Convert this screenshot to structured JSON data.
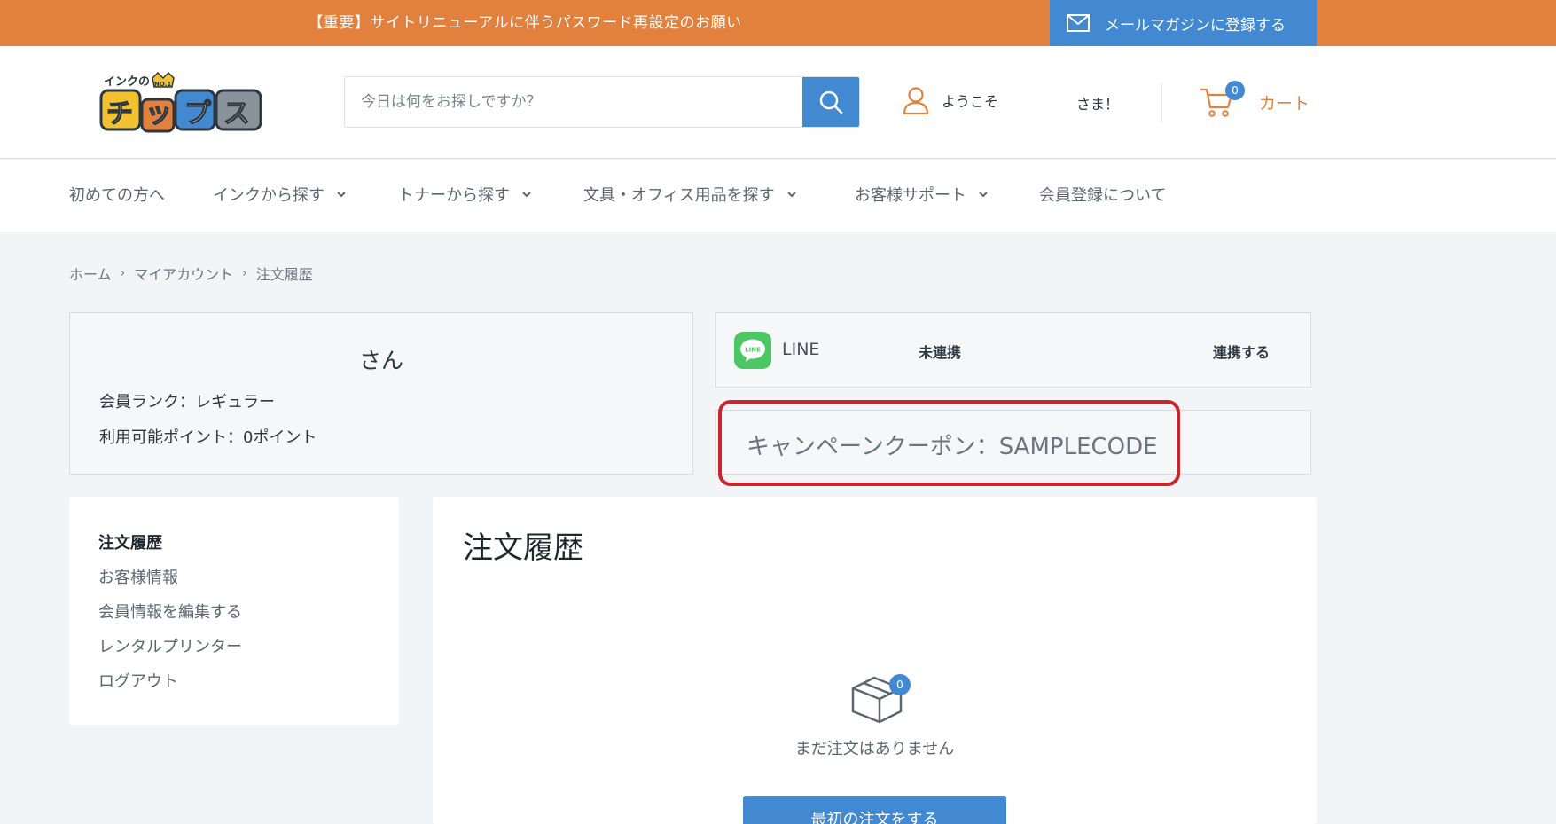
{
  "announcement": {
    "text": "【重要】サイトリニューアルに伴うパスワード再設定のお願い",
    "newsletter_label": "メールマガジンに登録する"
  },
  "header": {
    "logo_alt": "インクのチップス",
    "logo_small": "インクの",
    "logo_main": "チップス",
    "logo_badge": "NO.1",
    "search_placeholder": "今日は何をお探しですか？",
    "welcome": "ようこそ",
    "honorific": "さま！",
    "cart_label": "カート",
    "cart_count": "0"
  },
  "nav": {
    "items": [
      {
        "label": "初めての方へ",
        "dropdown": false
      },
      {
        "label": "インクから探す",
        "dropdown": true
      },
      {
        "label": "トナーから探す",
        "dropdown": true
      },
      {
        "label": "文具・オフィス用品を探す",
        "dropdown": true
      },
      {
        "label": "お客様サポート",
        "dropdown": true
      },
      {
        "label": "会員登録について",
        "dropdown": false
      }
    ]
  },
  "breadcrumb": [
    "ホーム",
    "マイアカウント",
    "注文履歴"
  ],
  "account": {
    "name": "さん",
    "rank": "会員ランク：レギュラー",
    "points": "利用可能ポイント：0ポイント"
  },
  "line": {
    "icon_text": "LINE",
    "label": "LINE",
    "status": "未連携",
    "link": "連携する"
  },
  "coupon": {
    "text": "キャンペーンクーポン：SAMPLECODE"
  },
  "sidebar": {
    "items": [
      "注文履歴",
      "お客様情報",
      "会員情報を編集する",
      "レンタルプリンター",
      "ログアウト"
    ]
  },
  "main": {
    "title": "注文履歴",
    "order_count": "0",
    "empty_text": "まだ注文はありません",
    "first_order_button": "最初の注文をする"
  },
  "colors": {
    "accent_orange": "#e1813d",
    "accent_blue": "#4289d2",
    "highlight_red": "#c9252d",
    "line_green": "#4cc764"
  }
}
